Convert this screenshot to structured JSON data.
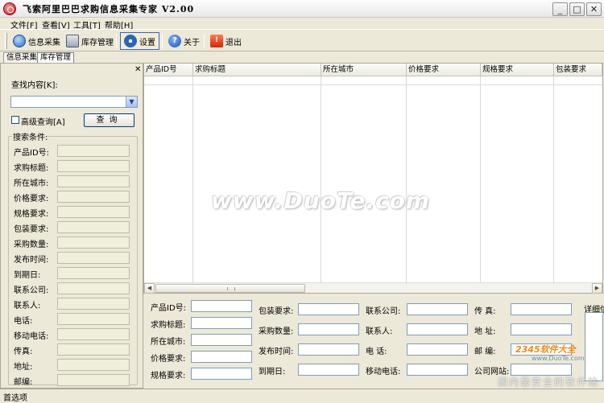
{
  "window": {
    "title": "飞索阿里巴巴求购信息采集专家  V2.00"
  },
  "window_buttons": [
    "_",
    "□",
    "✕"
  ],
  "menu": [
    "文件[F]",
    "查看[V]",
    "工具[T]",
    "帮助[H]"
  ],
  "toolbar": [
    {
      "label": "信息采集",
      "icon": "globe-icon"
    },
    {
      "label": "库存管理",
      "icon": "store-icon"
    },
    {
      "label": "设置",
      "icon": "gear-icon"
    },
    {
      "label": "关于",
      "icon": "help-icon"
    },
    {
      "label": "退出",
      "icon": "exit-icon"
    }
  ],
  "tabs": [
    "信息采集",
    "库存管理"
  ],
  "left_panel": {
    "close": "✕",
    "find_label": "查找内容[K]:",
    "combo_value": "",
    "advanced_label": "高级查询[A]",
    "query_button": "查询",
    "group_title": "搜索条件:",
    "fields": [
      "产品ID号:",
      "求购标题:",
      "所在城市:",
      "价格要求:",
      "规格要求:",
      "包装要求:",
      "采购数量:",
      "发布时间:",
      "到期日:",
      "联系公司:",
      "联系人:",
      "电话:",
      "移动电话:",
      "传真:",
      "地址:",
      "邮编:"
    ]
  },
  "grid": {
    "columns": [
      "产品ID号",
      "求购标题",
      "所在城市",
      "价格要求",
      "规格要求",
      "包装要求"
    ],
    "rows": []
  },
  "detail": {
    "col1": [
      "产品ID号:",
      "求购标题:",
      "所在城市:",
      "价格要求:",
      "规格要求:"
    ],
    "col2": [
      "包装要求:",
      "采购数量:",
      "发布时间:",
      "到期日:"
    ],
    "col3": [
      "联系公司:",
      "联系人:",
      "电    话:",
      "移动电话:"
    ],
    "col4": [
      "传    真:",
      "地    址:",
      "邮    编:",
      "公司网站:"
    ],
    "detail_label": "详细信"
  },
  "status": "首选项",
  "watermark": {
    "main": "www.DuoTe.com",
    "site": "2345软件大全",
    "url": "www.DuoTe.com",
    "slogan": "国内最安全的软件站"
  }
}
